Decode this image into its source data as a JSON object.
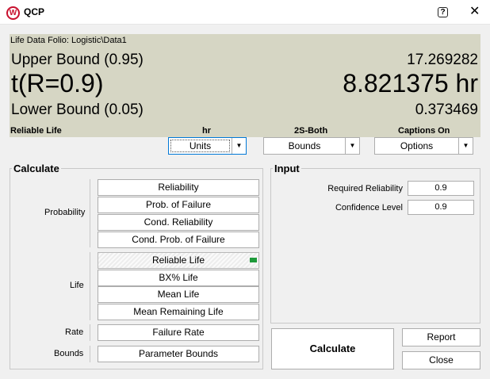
{
  "window": {
    "title": "QCP",
    "app_icon_letter": "W"
  },
  "results": {
    "folio": "Life Data Folio: Logistic\\Data1",
    "upper_label": "Upper Bound (0.95)",
    "upper_value": "17.269282",
    "main_label": "t(R=0.9)",
    "main_value": "8.821375 hr",
    "lower_label": "Lower Bound (0.05)",
    "lower_value": "0.373469",
    "status_method": "Reliable Life",
    "status_units": "hr",
    "status_bounds": "2S-Both",
    "status_captions": "Captions On"
  },
  "controls": {
    "units_label": "Units",
    "bounds_label": "Bounds",
    "options_label": "Options"
  },
  "calculate": {
    "legend": "Calculate",
    "probability_label": "Probability",
    "life_label": "Life",
    "rate_label": "Rate",
    "bounds_label": "Bounds",
    "reliability": "Reliability",
    "prob_failure": "Prob. of Failure",
    "cond_reliability": "Cond. Reliability",
    "cond_prob_failure": "Cond. Prob. of Failure",
    "reliable_life": "Reliable Life",
    "bx_life": "BX% Life",
    "mean_life": "Mean Life",
    "mean_remaining_life": "Mean Remaining Life",
    "failure_rate": "Failure Rate",
    "parameter_bounds": "Parameter Bounds"
  },
  "input": {
    "legend": "Input",
    "required_reliability_label": "Required Reliability",
    "required_reliability_value": "0.9",
    "confidence_level_label": "Confidence Level",
    "confidence_level_value": "0.9"
  },
  "actions": {
    "calculate": "Calculate",
    "report": "Report",
    "close": "Close"
  },
  "colors": {
    "results_bg": "#d6d6c4",
    "indicator_green": "#1e9a3a",
    "brand_red": "#c8102e"
  }
}
